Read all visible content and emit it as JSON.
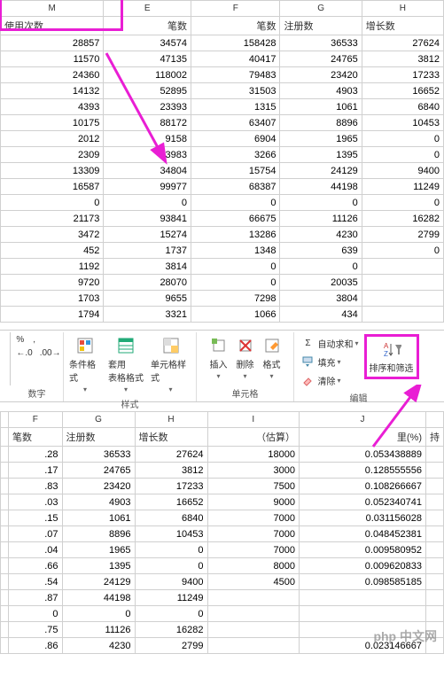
{
  "table1": {
    "col_letters": [
      "M",
      "E",
      "F",
      "G",
      "H"
    ],
    "headers": [
      "使用次数",
      "笔数",
      "笔数",
      "注册数",
      "增长数"
    ],
    "highlight_value": "34574",
    "rows": [
      [
        "28857",
        "34574",
        "158428",
        "36533",
        "27624"
      ],
      [
        "11570",
        "47135",
        "40417",
        "24765",
        "3812"
      ],
      [
        "24360",
        "118002",
        "79483",
        "23420",
        "17233"
      ],
      [
        "14132",
        "52895",
        "31503",
        "4903",
        "16652"
      ],
      [
        "4393",
        "23393",
        "1315",
        "1061",
        "6840"
      ],
      [
        "10175",
        "88172",
        "63407",
        "8896",
        "10453"
      ],
      [
        "2012",
        "9158",
        "6904",
        "1965",
        "0"
      ],
      [
        "2309",
        "3983",
        "3266",
        "1395",
        "0"
      ],
      [
        "13309",
        "34804",
        "15754",
        "24129",
        "9400"
      ],
      [
        "16587",
        "99977",
        "68387",
        "44198",
        "11249"
      ],
      [
        "0",
        "0",
        "0",
        "0",
        "0"
      ],
      [
        "21173",
        "93841",
        "66675",
        "11126",
        "16282"
      ],
      [
        "3472",
        "15274",
        "13286",
        "4230",
        "2799"
      ],
      [
        "452",
        "1737",
        "1348",
        "639",
        "0"
      ],
      [
        "1192",
        "3814",
        "0",
        "0",
        ""
      ],
      [
        "9720",
        "28070",
        "0",
        "20035",
        ""
      ],
      [
        "1703",
        "9655",
        "7298",
        "3804",
        ""
      ],
      [
        "1794",
        "3321",
        "1066",
        "434",
        ""
      ]
    ]
  },
  "ribbon": {
    "number_group": "数字",
    "percent": "%",
    "comma": ",",
    "dec_inc": ".0",
    "dec_dec": ".00",
    "cond_fmt": "条件格式",
    "table_fmt": "套用\n表格格式",
    "cell_style": "单元格样式",
    "style_group": "样式",
    "insert": "插入",
    "delete": "删除",
    "format": "格式",
    "cell_group": "单元格",
    "autosum": "自动求和",
    "fill": "填充",
    "clear": "清除",
    "sort_filter": "排序和筛选",
    "edit_group": "编辑"
  },
  "table2": {
    "col_letters": [
      "F",
      "G",
      "H",
      "I",
      "J"
    ],
    "headers": [
      "笔数",
      "注册数",
      "增长数",
      "（估算）",
      "里(%)"
    ],
    "rows": [
      [
        ".28",
        "36533",
        "27624",
        "18000",
        "0.053438889"
      ],
      [
        ".17",
        "24765",
        "3812",
        "3000",
        "0.128555556"
      ],
      [
        ".83",
        "23420",
        "17233",
        "7500",
        "0.108266667"
      ],
      [
        ".03",
        "4903",
        "16652",
        "9000",
        "0.052340741"
      ],
      [
        ".15",
        "1061",
        "6840",
        "7000",
        "0.031156028"
      ],
      [
        ".07",
        "8896",
        "10453",
        "7000",
        "0.048452381"
      ],
      [
        ".04",
        "1965",
        "0",
        "7000",
        "0.009580952"
      ],
      [
        ".66",
        "1395",
        "0",
        "8000",
        "0.009620833"
      ],
      [
        ".54",
        "24129",
        "9400",
        "4500",
        "0.098585185"
      ],
      [
        ".87",
        "44198",
        "11249",
        "",
        ""
      ],
      [
        "0",
        "0",
        "0",
        "",
        ""
      ],
      [
        ".75",
        "11126",
        "16282",
        "",
        ""
      ],
      [
        ".86",
        "4230",
        "2799",
        "",
        "0.023146667"
      ]
    ],
    "last_col_hint": "持"
  },
  "watermark": "php 中文网"
}
